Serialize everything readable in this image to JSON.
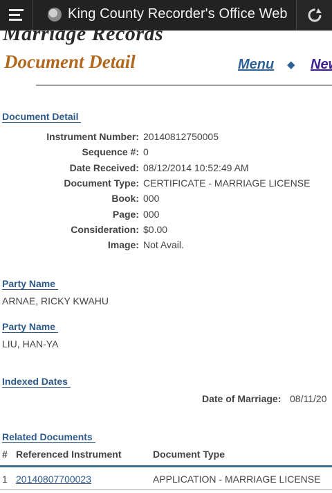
{
  "app_bar": {
    "title": "King County Recorder's Office Web"
  },
  "header": {
    "section_title": "Marriage Records",
    "page_title": "Document Detail",
    "nav_menu": "Menu",
    "nav_separator": "◆",
    "nav_new": "New"
  },
  "document_detail": {
    "heading": "Document Detail",
    "fields": [
      {
        "label": "Instrument Number:",
        "value": "20140812750005"
      },
      {
        "label": "Sequence #:",
        "value": "0"
      },
      {
        "label": "Date Received:",
        "value": "08/12/2014 10:52:49 AM"
      },
      {
        "label": "Document Type:",
        "value": "CERTIFICATE - MARRIAGE LICENSE"
      },
      {
        "label": "Book:",
        "value": "000"
      },
      {
        "label": "Page:",
        "value": "000"
      },
      {
        "label": "Consideration:",
        "value": "$0.00"
      },
      {
        "label": "Image:",
        "value": "Not Avail."
      }
    ]
  },
  "parties": [
    {
      "heading": "Party Name",
      "name": "ARNAE, RICKY KWAHU"
    },
    {
      "heading": "Party Name",
      "name": "LIU, HAN-YA"
    }
  ],
  "indexed_dates": {
    "heading": "Indexed Dates",
    "label": "Date of Marriage:",
    "value": "08/11/20"
  },
  "related_documents": {
    "heading": "Related Documents",
    "columns": [
      "#",
      "Referenced Instrument",
      "Document Type"
    ],
    "rows": [
      {
        "num": "1",
        "instrument": "20140807700023",
        "type": "APPLICATION - MARRIAGE LICENSE"
      }
    ]
  },
  "icons": {
    "menu": "hamburger-menu-icon",
    "app": "app-logo-icon",
    "refresh": "refresh-icon"
  }
}
